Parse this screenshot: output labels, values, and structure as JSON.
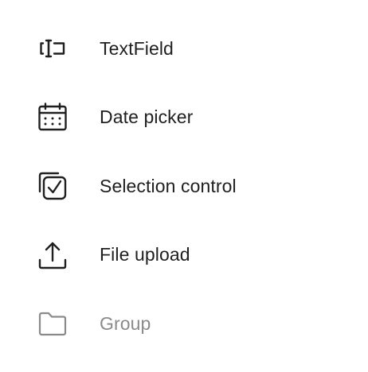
{
  "menu": {
    "items": [
      {
        "label": "TextField",
        "icon": "text-field-icon",
        "enabled": true
      },
      {
        "label": "Date picker",
        "icon": "calendar-icon",
        "enabled": true
      },
      {
        "label": "Selection control",
        "icon": "checkbox-stack-icon",
        "enabled": true
      },
      {
        "label": "File upload",
        "icon": "upload-icon",
        "enabled": true
      },
      {
        "label": "Group",
        "icon": "folder-icon",
        "enabled": false
      }
    ]
  },
  "colors": {
    "text": "#1f1f1f",
    "disabled_text": "#8a8a8a",
    "background": "#ffffff"
  }
}
